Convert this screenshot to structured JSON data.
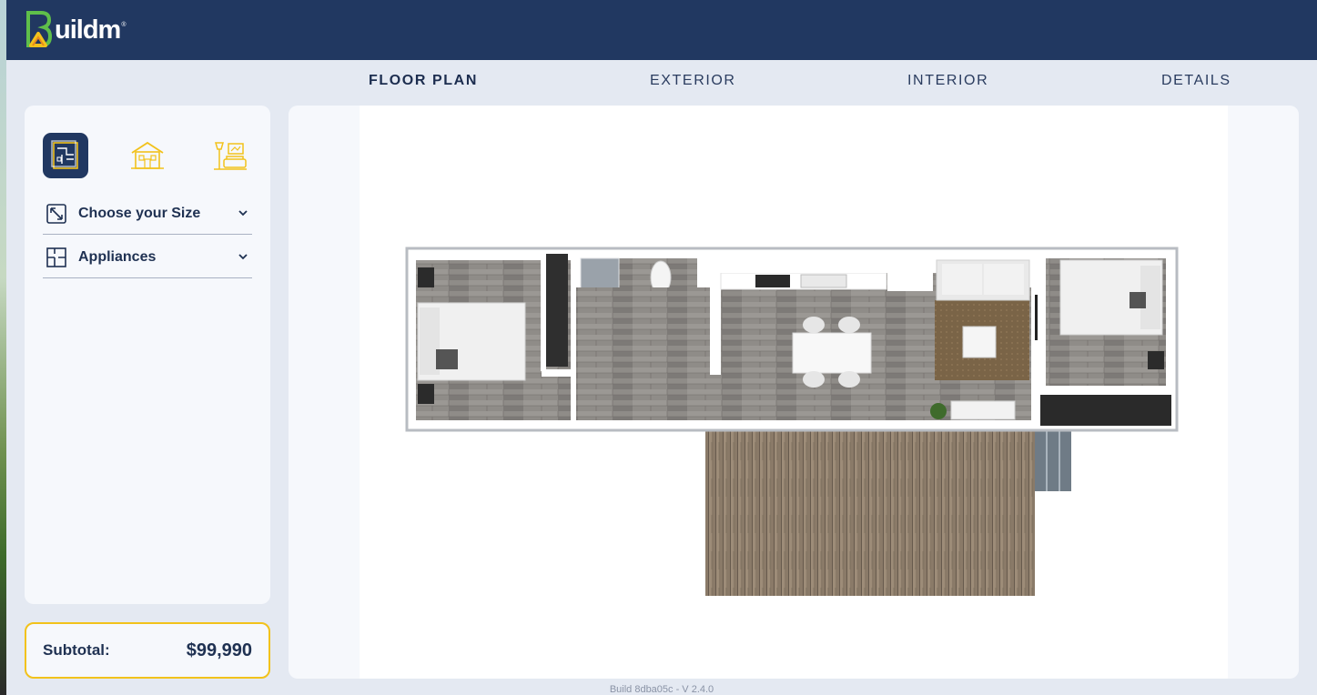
{
  "app": {
    "brand": "uildm",
    "colors": {
      "navy": "#213861",
      "accent": "#f2c21b",
      "green": "#5fbf4a"
    }
  },
  "tabs": [
    {
      "label": "FLOOR PLAN",
      "active": true
    },
    {
      "label": "EXTERIOR",
      "active": false
    },
    {
      "label": "INTERIOR",
      "active": false
    },
    {
      "label": "DETAILS",
      "active": false
    }
  ],
  "sidebar": {
    "modes": [
      {
        "icon": "floor-plan-icon",
        "active": true
      },
      {
        "icon": "house-exterior-icon",
        "active": false
      },
      {
        "icon": "interior-room-icon",
        "active": false
      }
    ],
    "sections": [
      {
        "label": "Choose your Size",
        "icon": "resize-icon",
        "expanded": false
      },
      {
        "label": "Appliances",
        "icon": "layout-icon",
        "expanded": false
      }
    ]
  },
  "subtotal": {
    "label": "Subtotal:",
    "value": "$99,990"
  },
  "footer": {
    "build": "Build 8dba05c - V 2.4.0"
  }
}
